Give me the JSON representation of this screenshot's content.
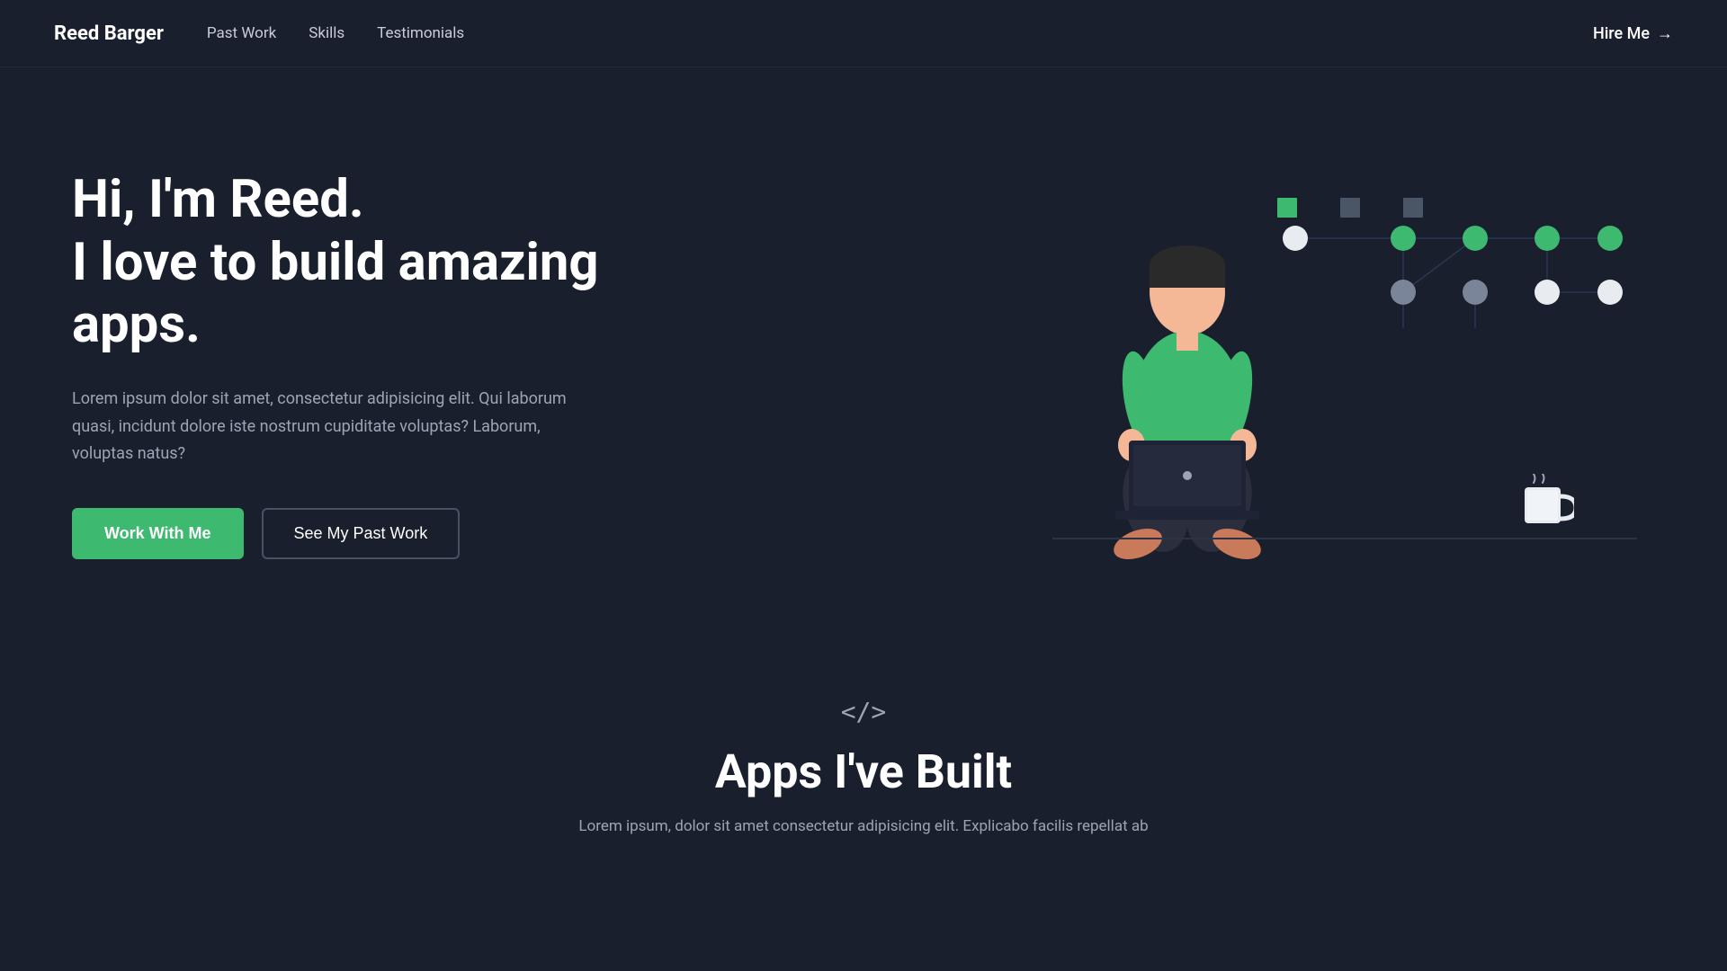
{
  "nav": {
    "brand": "Reed Barger",
    "links": [
      {
        "label": "Past Work",
        "href": "#past-work"
      },
      {
        "label": "Skills",
        "href": "#skills"
      },
      {
        "label": "Testimonials",
        "href": "#testimonials"
      }
    ],
    "hire_label": "Hire Me",
    "hire_arrow": "→"
  },
  "hero": {
    "title_line1": "Hi, I'm Reed.",
    "title_line2": "I love to build amazing apps.",
    "description": "Lorem ipsum dolor sit amet, consectetur adipisicing elit. Qui laborum quasi, incidunt dolore iste nostrum cupiditate voluptas? Laborum, voluptas natus?",
    "btn_primary": "Work With Me",
    "btn_secondary": "See My Past Work"
  },
  "apps_section": {
    "icon": "</>",
    "title": "Apps I've Built",
    "description": "Lorem ipsum, dolor sit amet consectetur adipisicing elit. Explicabo facilis repellat ab"
  },
  "colors": {
    "bg": "#1a1f2e",
    "green": "#3dba6f",
    "text_muted": "#9da5b4",
    "border": "#4a5165",
    "node_green": "#3dba6f",
    "node_light": "#8a9ab5",
    "node_white": "#e8ecf0",
    "square_green": "#3dba6f",
    "square_gray": "#4a5165"
  }
}
